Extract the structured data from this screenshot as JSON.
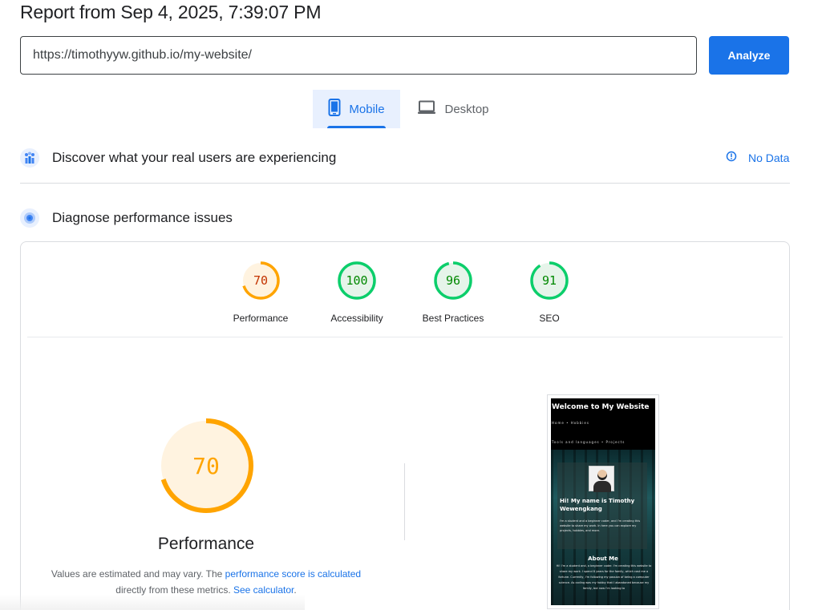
{
  "report": {
    "title": "Report from Sep 4, 2025, 7:39:07 PM"
  },
  "search": {
    "url": "https://timothyyw.github.io/my-website/",
    "analyze_label": "Analyze"
  },
  "tabs": [
    {
      "label": "Mobile",
      "icon": "phone-icon",
      "selected": true
    },
    {
      "label": "Desktop",
      "icon": "laptop-icon",
      "selected": false
    }
  ],
  "field_data": {
    "heading": "Discover what your real users are experiencing",
    "status": "No Data"
  },
  "lab_data": {
    "heading": "Diagnose performance issues"
  },
  "scores": [
    {
      "label": "Performance",
      "value": 70,
      "color": "#ffa400",
      "text_color": "#c33300",
      "bg": "#fff3e0"
    },
    {
      "label": "Accessibility",
      "value": 100,
      "color": "#0cce6b",
      "text_color": "#008800",
      "bg": "#e6f4ea"
    },
    {
      "label": "Best Practices",
      "value": 96,
      "color": "#0cce6b",
      "text_color": "#008800",
      "bg": "#e6f4ea"
    },
    {
      "label": "SEO",
      "value": 91,
      "color": "#0cce6b",
      "text_color": "#008800",
      "bg": "#e6f4ea"
    }
  ],
  "performance": {
    "score": 70,
    "label": "Performance",
    "note_prefix": "Values are estimated and may vary. The ",
    "note_link1": "performance score is calculated",
    "note_middle": " directly from these metrics. ",
    "note_link2": "See calculator",
    "note_suffix": "."
  },
  "screenshot": {
    "title": "Welcome to My Website",
    "nav1": "Home • Hobbies",
    "nav2": "Tools and languages • Projects",
    "greeting": "Hi! My name is Timothy Wewengkang",
    "intro": "I'm a student and a beginner coder, and I'm creating this website to share my work. In here you can explore my projects, hobbies, and more.",
    "about_heading": "About Me",
    "about_text": "Hi! I'm a student and, a beginner coder. I'm creating this website to share my work. I spend 8 years for the family, which cost me a fortune. Currently, I'm following my passion of being a computer science. As coding was my hobby that I abandoned because my family, but now I'm looking to"
  },
  "colors": {
    "accent": "#1a73e8",
    "average": "#ffa400",
    "pass": "#0cce6b"
  }
}
